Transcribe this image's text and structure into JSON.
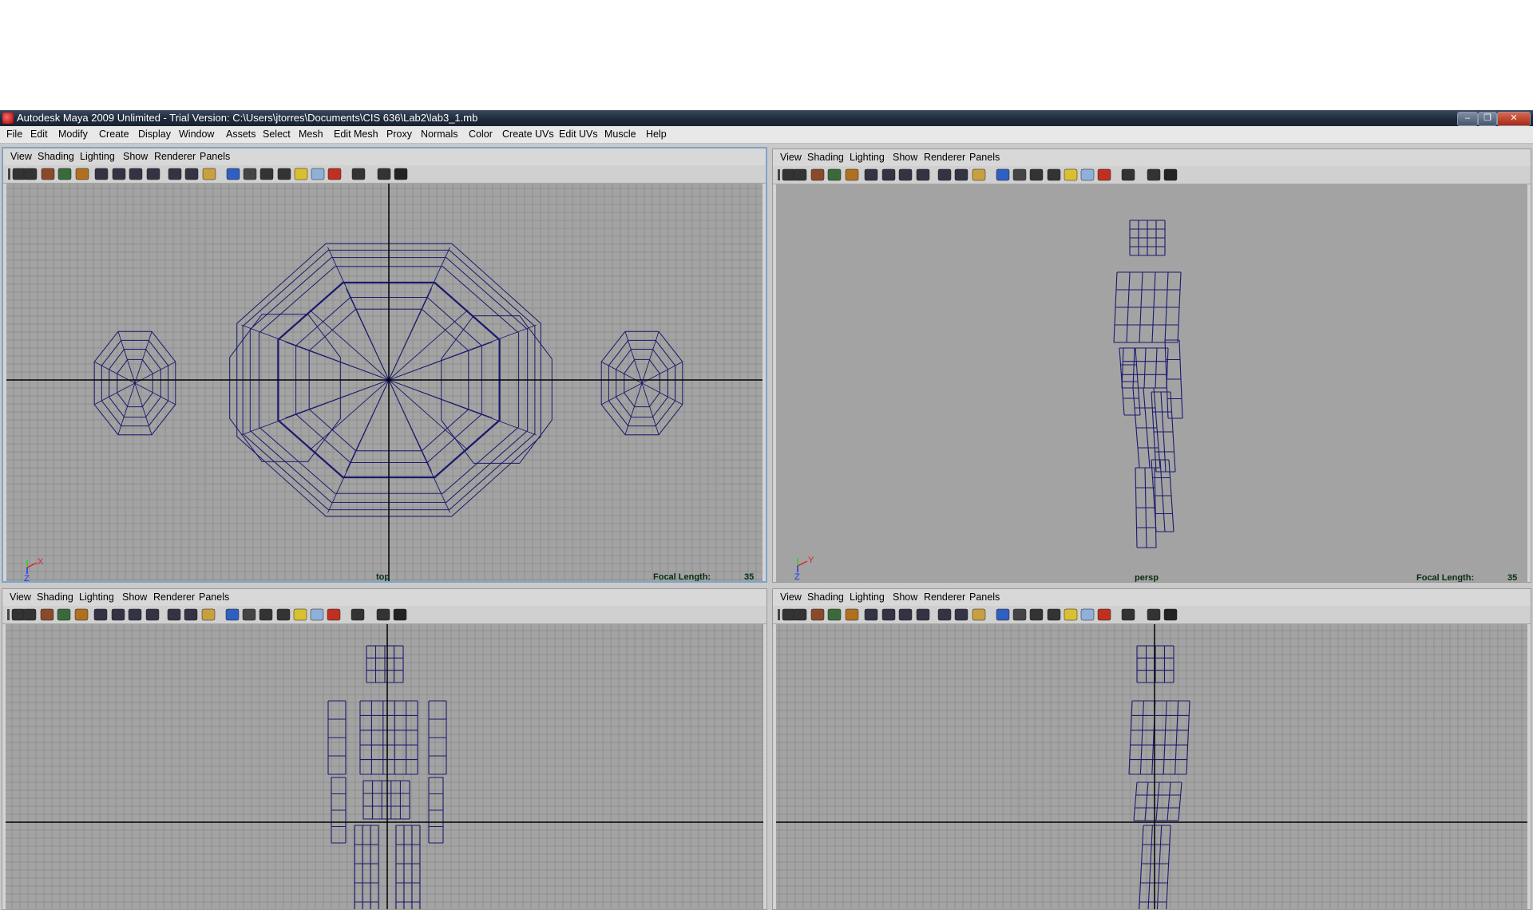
{
  "window": {
    "title": "Autodesk Maya 2009 Unlimited - Trial Version: C:\\Users\\jtorres\\Documents\\CIS 636\\Lab2\\lab3_1.mb",
    "minimize": "‒",
    "restore": "❐",
    "close": "✕"
  },
  "menubar": [
    "File",
    "Edit",
    "Modify",
    "Create",
    "Display",
    "Window",
    "Assets",
    "Select",
    "Mesh",
    "Edit Mesh",
    "Proxy",
    "Normals",
    "Color",
    "Create UVs",
    "Edit UVs",
    "Muscle",
    "Help"
  ],
  "panel_menu": [
    "View",
    "Shading",
    "Lighting",
    "Show",
    "Renderer",
    "Panels"
  ],
  "colors": {
    "viewport_bg": "#a3a3a3",
    "grid_line": "#8f8f8f",
    "wireframe": "#19196e",
    "axis": "#000000",
    "camera_label": "#062f0e",
    "active_border": "#7fa3c9"
  },
  "panels": {
    "top_left": {
      "camera": "top",
      "focal_label": "Focal Length:",
      "focal_value": "35",
      "axis_a": "X",
      "axis_b": "Z"
    },
    "top_right": {
      "camera": "persp",
      "focal_label": "Focal Length:",
      "focal_value": "35",
      "axis_a": "Y",
      "axis_b": "Z"
    },
    "bottom_left": {
      "camera": "",
      "focal_label": "",
      "focal_value": ""
    },
    "bottom_right": {
      "camera": "",
      "focal_label": "",
      "focal_value": ""
    }
  },
  "toolbar_icons": [
    "camera-icon",
    "camera-attr-icon",
    "bookmark-icon",
    "image-plane-icon",
    "grid-toggle-icon",
    "film-gate-icon",
    "resolution-gate-icon",
    "gate-mask-icon",
    "field-chart-icon",
    "safe-action-icon",
    "safe-title-icon",
    "wireframe-icon",
    "smooth-shade-icon",
    "flat-shade-icon",
    "bounding-box-icon",
    "use-lights-icon",
    "texture-icon",
    "shadow-icon",
    "isolate-select-icon",
    "xray-icon",
    "xray-joints-icon",
    "hud-icon"
  ]
}
